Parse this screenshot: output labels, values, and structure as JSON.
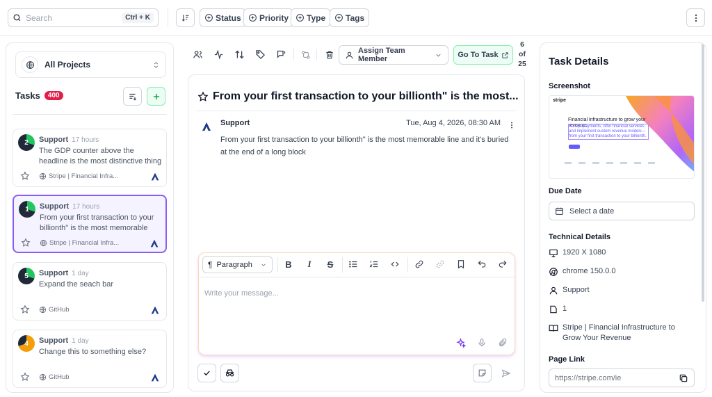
{
  "topbar": {
    "search_placeholder": "Search",
    "search_shortcut": "Ctrl + K",
    "filters": [
      {
        "label": "Status"
      },
      {
        "label": "Priority"
      },
      {
        "label": "Type"
      },
      {
        "label": "Tags"
      }
    ]
  },
  "sidebar": {
    "project": "All Projects",
    "tasks_title": "Tasks",
    "tasks_count": "400",
    "cards": [
      {
        "number": "2",
        "category": "Support",
        "time": "17 hours",
        "title": "The GDP counter above the headline is the most distinctive thing on the...",
        "source": "Stripe | Financial Infra...",
        "color": "#22c55e",
        "progress": 0.3
      },
      {
        "number": "1",
        "category": "Support",
        "time": "17 hours",
        "title": "From your first transaction to your billionth\" is the most memorable line...",
        "source": "Stripe | Financial Infra...",
        "color": "#22c55e",
        "progress": 0.3,
        "selected": true
      },
      {
        "number": "5",
        "category": "Support",
        "time": "1 day",
        "title": "Expand the seach bar",
        "source": "GitHub",
        "color": "#22c55e",
        "progress": 0.3
      },
      {
        "number": "4",
        "category": "Support",
        "time": "1 day",
        "title": "Change this to something else?",
        "source": "GitHub",
        "color": "#f59e0b",
        "progress": 0.7
      }
    ]
  },
  "center": {
    "assign_label": "Assign Team Member",
    "goto_label": "Go To Task",
    "pager": {
      "current": "6",
      "of": "of",
      "total": "25"
    },
    "task_title": "From your first transaction to your billionth\" is the most...",
    "message": {
      "author": "Support",
      "date": "Tue, Aug 4, 2026, 08:30 AM",
      "body": "From your first transaction to your billionth\" is the most memorable line and it's buried at the end of a long block"
    },
    "editor": {
      "block_type": "Paragraph",
      "placeholder": "Write your message..."
    }
  },
  "details": {
    "title": "Task Details",
    "screenshot_label": "Screenshot",
    "screenshot_headline": "Financial infrastructure to grow your revenue.",
    "screenshot_sub": "Accept payments, offer financial services and implement custom revenue models – from your first transaction to your billionth.",
    "screenshot_logo": "stripe",
    "due_label": "Due Date",
    "due_placeholder": "Select a date",
    "tech_label": "Technical Details",
    "resolution": "1920 X 1080",
    "browser": "chrome 150.0.0",
    "category": "Support",
    "number": "1",
    "page_title": "Stripe | Financial Infrastructure to Grow Your Revenue",
    "page_link_label": "Page Link",
    "page_link": "https://stripe.com/ie"
  },
  "colors": {
    "accent": "#8b5cf6",
    "green": "#22c55e",
    "badge": "#e11d48"
  }
}
